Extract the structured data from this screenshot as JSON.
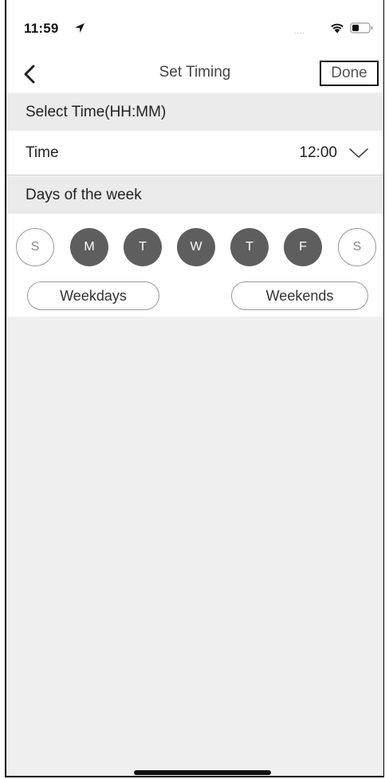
{
  "status_bar": {
    "time": "11:59",
    "location_icon": "location-arrow-icon",
    "signal_dots": "....",
    "wifi_icon": "wifi-icon",
    "battery_icon": "battery-icon"
  },
  "nav": {
    "back_icon": "chevron-left-icon",
    "title": "Set Timing",
    "done_label": "Done"
  },
  "time_section": {
    "header": "Select Time(HH:MM)",
    "label": "Time",
    "value": "12:00",
    "dropdown_icon": "chevron-down-icon"
  },
  "days_section": {
    "header": "Days of the week",
    "days": [
      {
        "label": "S",
        "selected": false
      },
      {
        "label": "M",
        "selected": true
      },
      {
        "label": "T",
        "selected": true
      },
      {
        "label": "W",
        "selected": true
      },
      {
        "label": "T",
        "selected": true
      },
      {
        "label": "F",
        "selected": true
      },
      {
        "label": "S",
        "selected": false
      }
    ],
    "weekdays_label": "Weekdays",
    "weekends_label": "Weekends"
  },
  "colors": {
    "selected_day": "#5e5e5e",
    "background": "#f0f0f0",
    "section_header": "#ebebeb"
  }
}
